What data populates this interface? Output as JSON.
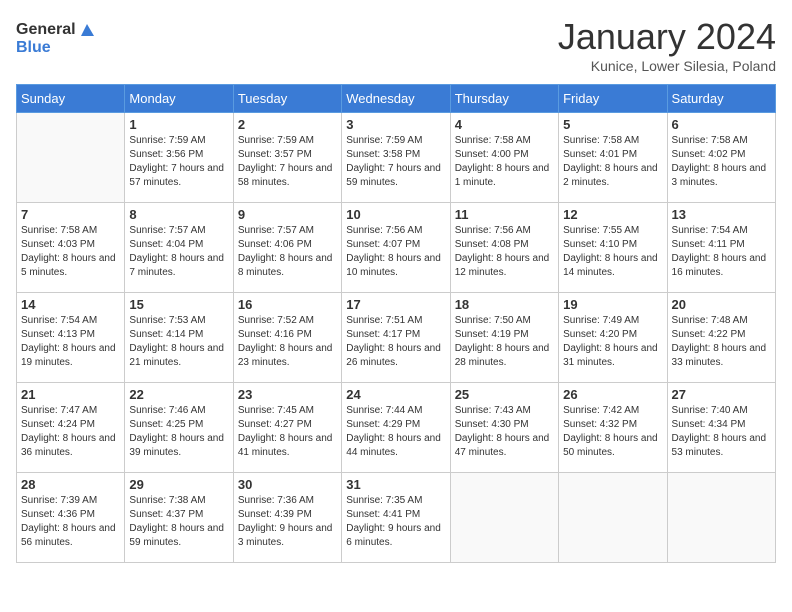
{
  "header": {
    "logo_general": "General",
    "logo_blue": "Blue",
    "month_title": "January 2024",
    "subtitle": "Kunice, Lower Silesia, Poland"
  },
  "weekdays": [
    "Sunday",
    "Monday",
    "Tuesday",
    "Wednesday",
    "Thursday",
    "Friday",
    "Saturday"
  ],
  "weeks": [
    [
      {
        "day": "",
        "sunrise": "",
        "sunset": "",
        "daylight": "",
        "empty": true
      },
      {
        "day": "1",
        "sunrise": "Sunrise: 7:59 AM",
        "sunset": "Sunset: 3:56 PM",
        "daylight": "Daylight: 7 hours and 57 minutes."
      },
      {
        "day": "2",
        "sunrise": "Sunrise: 7:59 AM",
        "sunset": "Sunset: 3:57 PM",
        "daylight": "Daylight: 7 hours and 58 minutes."
      },
      {
        "day": "3",
        "sunrise": "Sunrise: 7:59 AM",
        "sunset": "Sunset: 3:58 PM",
        "daylight": "Daylight: 7 hours and 59 minutes."
      },
      {
        "day": "4",
        "sunrise": "Sunrise: 7:58 AM",
        "sunset": "Sunset: 4:00 PM",
        "daylight": "Daylight: 8 hours and 1 minute."
      },
      {
        "day": "5",
        "sunrise": "Sunrise: 7:58 AM",
        "sunset": "Sunset: 4:01 PM",
        "daylight": "Daylight: 8 hours and 2 minutes."
      },
      {
        "day": "6",
        "sunrise": "Sunrise: 7:58 AM",
        "sunset": "Sunset: 4:02 PM",
        "daylight": "Daylight: 8 hours and 3 minutes."
      }
    ],
    [
      {
        "day": "7",
        "sunrise": "Sunrise: 7:58 AM",
        "sunset": "Sunset: 4:03 PM",
        "daylight": "Daylight: 8 hours and 5 minutes."
      },
      {
        "day": "8",
        "sunrise": "Sunrise: 7:57 AM",
        "sunset": "Sunset: 4:04 PM",
        "daylight": "Daylight: 8 hours and 7 minutes."
      },
      {
        "day": "9",
        "sunrise": "Sunrise: 7:57 AM",
        "sunset": "Sunset: 4:06 PM",
        "daylight": "Daylight: 8 hours and 8 minutes."
      },
      {
        "day": "10",
        "sunrise": "Sunrise: 7:56 AM",
        "sunset": "Sunset: 4:07 PM",
        "daylight": "Daylight: 8 hours and 10 minutes."
      },
      {
        "day": "11",
        "sunrise": "Sunrise: 7:56 AM",
        "sunset": "Sunset: 4:08 PM",
        "daylight": "Daylight: 8 hours and 12 minutes."
      },
      {
        "day": "12",
        "sunrise": "Sunrise: 7:55 AM",
        "sunset": "Sunset: 4:10 PM",
        "daylight": "Daylight: 8 hours and 14 minutes."
      },
      {
        "day": "13",
        "sunrise": "Sunrise: 7:54 AM",
        "sunset": "Sunset: 4:11 PM",
        "daylight": "Daylight: 8 hours and 16 minutes."
      }
    ],
    [
      {
        "day": "14",
        "sunrise": "Sunrise: 7:54 AM",
        "sunset": "Sunset: 4:13 PM",
        "daylight": "Daylight: 8 hours and 19 minutes."
      },
      {
        "day": "15",
        "sunrise": "Sunrise: 7:53 AM",
        "sunset": "Sunset: 4:14 PM",
        "daylight": "Daylight: 8 hours and 21 minutes."
      },
      {
        "day": "16",
        "sunrise": "Sunrise: 7:52 AM",
        "sunset": "Sunset: 4:16 PM",
        "daylight": "Daylight: 8 hours and 23 minutes."
      },
      {
        "day": "17",
        "sunrise": "Sunrise: 7:51 AM",
        "sunset": "Sunset: 4:17 PM",
        "daylight": "Daylight: 8 hours and 26 minutes."
      },
      {
        "day": "18",
        "sunrise": "Sunrise: 7:50 AM",
        "sunset": "Sunset: 4:19 PM",
        "daylight": "Daylight: 8 hours and 28 minutes."
      },
      {
        "day": "19",
        "sunrise": "Sunrise: 7:49 AM",
        "sunset": "Sunset: 4:20 PM",
        "daylight": "Daylight: 8 hours and 31 minutes."
      },
      {
        "day": "20",
        "sunrise": "Sunrise: 7:48 AM",
        "sunset": "Sunset: 4:22 PM",
        "daylight": "Daylight: 8 hours and 33 minutes."
      }
    ],
    [
      {
        "day": "21",
        "sunrise": "Sunrise: 7:47 AM",
        "sunset": "Sunset: 4:24 PM",
        "daylight": "Daylight: 8 hours and 36 minutes."
      },
      {
        "day": "22",
        "sunrise": "Sunrise: 7:46 AM",
        "sunset": "Sunset: 4:25 PM",
        "daylight": "Daylight: 8 hours and 39 minutes."
      },
      {
        "day": "23",
        "sunrise": "Sunrise: 7:45 AM",
        "sunset": "Sunset: 4:27 PM",
        "daylight": "Daylight: 8 hours and 41 minutes."
      },
      {
        "day": "24",
        "sunrise": "Sunrise: 7:44 AM",
        "sunset": "Sunset: 4:29 PM",
        "daylight": "Daylight: 8 hours and 44 minutes."
      },
      {
        "day": "25",
        "sunrise": "Sunrise: 7:43 AM",
        "sunset": "Sunset: 4:30 PM",
        "daylight": "Daylight: 8 hours and 47 minutes."
      },
      {
        "day": "26",
        "sunrise": "Sunrise: 7:42 AM",
        "sunset": "Sunset: 4:32 PM",
        "daylight": "Daylight: 8 hours and 50 minutes."
      },
      {
        "day": "27",
        "sunrise": "Sunrise: 7:40 AM",
        "sunset": "Sunset: 4:34 PM",
        "daylight": "Daylight: 8 hours and 53 minutes."
      }
    ],
    [
      {
        "day": "28",
        "sunrise": "Sunrise: 7:39 AM",
        "sunset": "Sunset: 4:36 PM",
        "daylight": "Daylight: 8 hours and 56 minutes."
      },
      {
        "day": "29",
        "sunrise": "Sunrise: 7:38 AM",
        "sunset": "Sunset: 4:37 PM",
        "daylight": "Daylight: 8 hours and 59 minutes."
      },
      {
        "day": "30",
        "sunrise": "Sunrise: 7:36 AM",
        "sunset": "Sunset: 4:39 PM",
        "daylight": "Daylight: 9 hours and 3 minutes."
      },
      {
        "day": "31",
        "sunrise": "Sunrise: 7:35 AM",
        "sunset": "Sunset: 4:41 PM",
        "daylight": "Daylight: 9 hours and 6 minutes."
      },
      {
        "day": "",
        "sunrise": "",
        "sunset": "",
        "daylight": "",
        "empty": true
      },
      {
        "day": "",
        "sunrise": "",
        "sunset": "",
        "daylight": "",
        "empty": true
      },
      {
        "day": "",
        "sunrise": "",
        "sunset": "",
        "daylight": "",
        "empty": true
      }
    ]
  ]
}
